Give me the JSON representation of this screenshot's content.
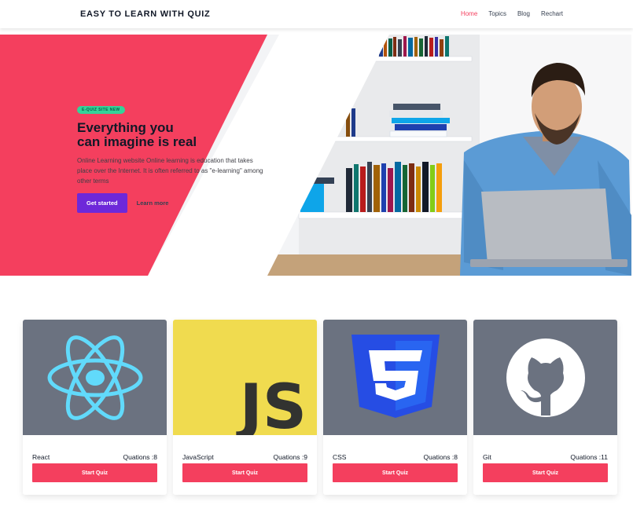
{
  "navbar": {
    "brand": "EASY TO LEARN WITH QUIZ",
    "links": [
      {
        "label": "Home",
        "active": true
      },
      {
        "label": "Topics",
        "active": false
      },
      {
        "label": "Blog",
        "active": false
      },
      {
        "label": "Rechart",
        "active": false
      }
    ]
  },
  "hero": {
    "badge": "E-QUIZ SITE NEW",
    "title_line1": "Everything you",
    "title_line2": "can imagine is real",
    "description": "Online Learning website Online learning is education that takes place over the Internet. It is often referred to as \"e-learning\" among other terms",
    "primary_button": "Get started",
    "secondary_link": "Learn more",
    "accent_color": "#f43f5e",
    "button_color": "#6d28d9"
  },
  "cards": [
    {
      "name": "React",
      "questions": "Quations :8",
      "button": "Start Quiz",
      "icon": "react-logo-icon"
    },
    {
      "name": "JavaScript",
      "questions": "Quations :9",
      "button": "Start Quiz",
      "icon": "javascript-logo-icon"
    },
    {
      "name": "CSS",
      "questions": "Quations :8",
      "button": "Start Quiz",
      "icon": "css3-logo-icon"
    },
    {
      "name": "Git",
      "questions": "Quations :11",
      "button": "Start Quiz",
      "icon": "github-logo-icon"
    }
  ]
}
